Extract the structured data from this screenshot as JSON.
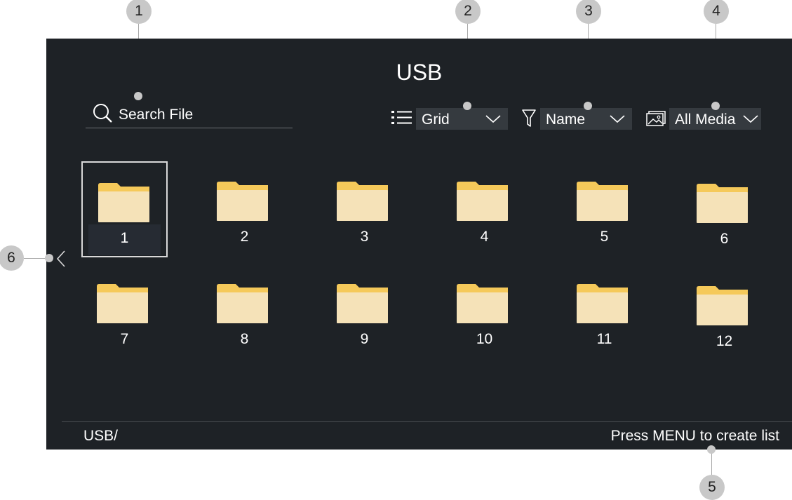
{
  "screen": {
    "title": "USB",
    "search": {
      "label": "Search File"
    },
    "view_dropdown": {
      "value": "Grid"
    },
    "sort_dropdown": {
      "value": "Name"
    },
    "media_dropdown": {
      "value": "All Media"
    },
    "folders": [
      {
        "name": "1",
        "selected": true
      },
      {
        "name": "2"
      },
      {
        "name": "3"
      },
      {
        "name": "4"
      },
      {
        "name": "5"
      },
      {
        "name": "6"
      },
      {
        "name": "7"
      },
      {
        "name": "8"
      },
      {
        "name": "9"
      },
      {
        "name": "10"
      },
      {
        "name": "11"
      },
      {
        "name": "12"
      }
    ],
    "footer": {
      "path": "USB/",
      "hint": "Press MENU to create list"
    }
  },
  "callouts": [
    "1",
    "2",
    "3",
    "4",
    "5",
    "6"
  ],
  "colors": {
    "background": "#1e2226",
    "folder_front": "#f5e2b8",
    "folder_back": "#f5c95a",
    "callout": "#c8c8c8"
  }
}
